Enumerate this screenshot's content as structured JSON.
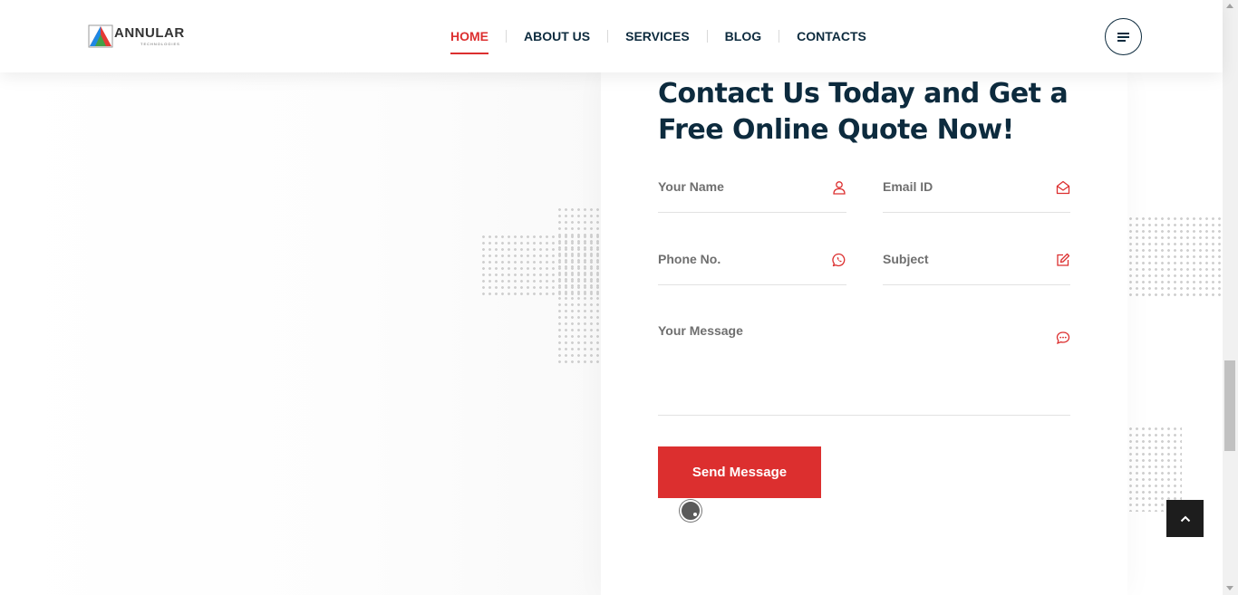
{
  "header": {
    "logo_text": "ANNULAR",
    "logo_subtext": "TECHNOLOGIES",
    "nav": [
      {
        "label": "HOME",
        "active": true
      },
      {
        "label": "ABOUT US",
        "active": false
      },
      {
        "label": "SERVICES",
        "active": false
      },
      {
        "label": "BLOG",
        "active": false
      },
      {
        "label": "CONTACTS",
        "active": false
      }
    ],
    "menu_icon": "hamburger-icon"
  },
  "contact": {
    "title": "Contact Us Today and Get a Free Online Quote Now!",
    "fields": {
      "name": {
        "placeholder": "Your Name",
        "icon": "user-icon"
      },
      "email": {
        "placeholder": "Email ID",
        "icon": "envelope-open-icon"
      },
      "phone": {
        "placeholder": "Phone No.",
        "icon": "whatsapp-icon"
      },
      "subject": {
        "placeholder": "Subject",
        "icon": "edit-icon"
      },
      "message": {
        "placeholder": "Your Message",
        "icon": "chat-icon"
      }
    },
    "submit_label": "Send Message"
  },
  "back_to_top_icon": "chevron-up-icon",
  "colors": {
    "accent": "#dc2f2f",
    "heading": "#0d2b3e",
    "placeholder": "#6f6f6f"
  }
}
